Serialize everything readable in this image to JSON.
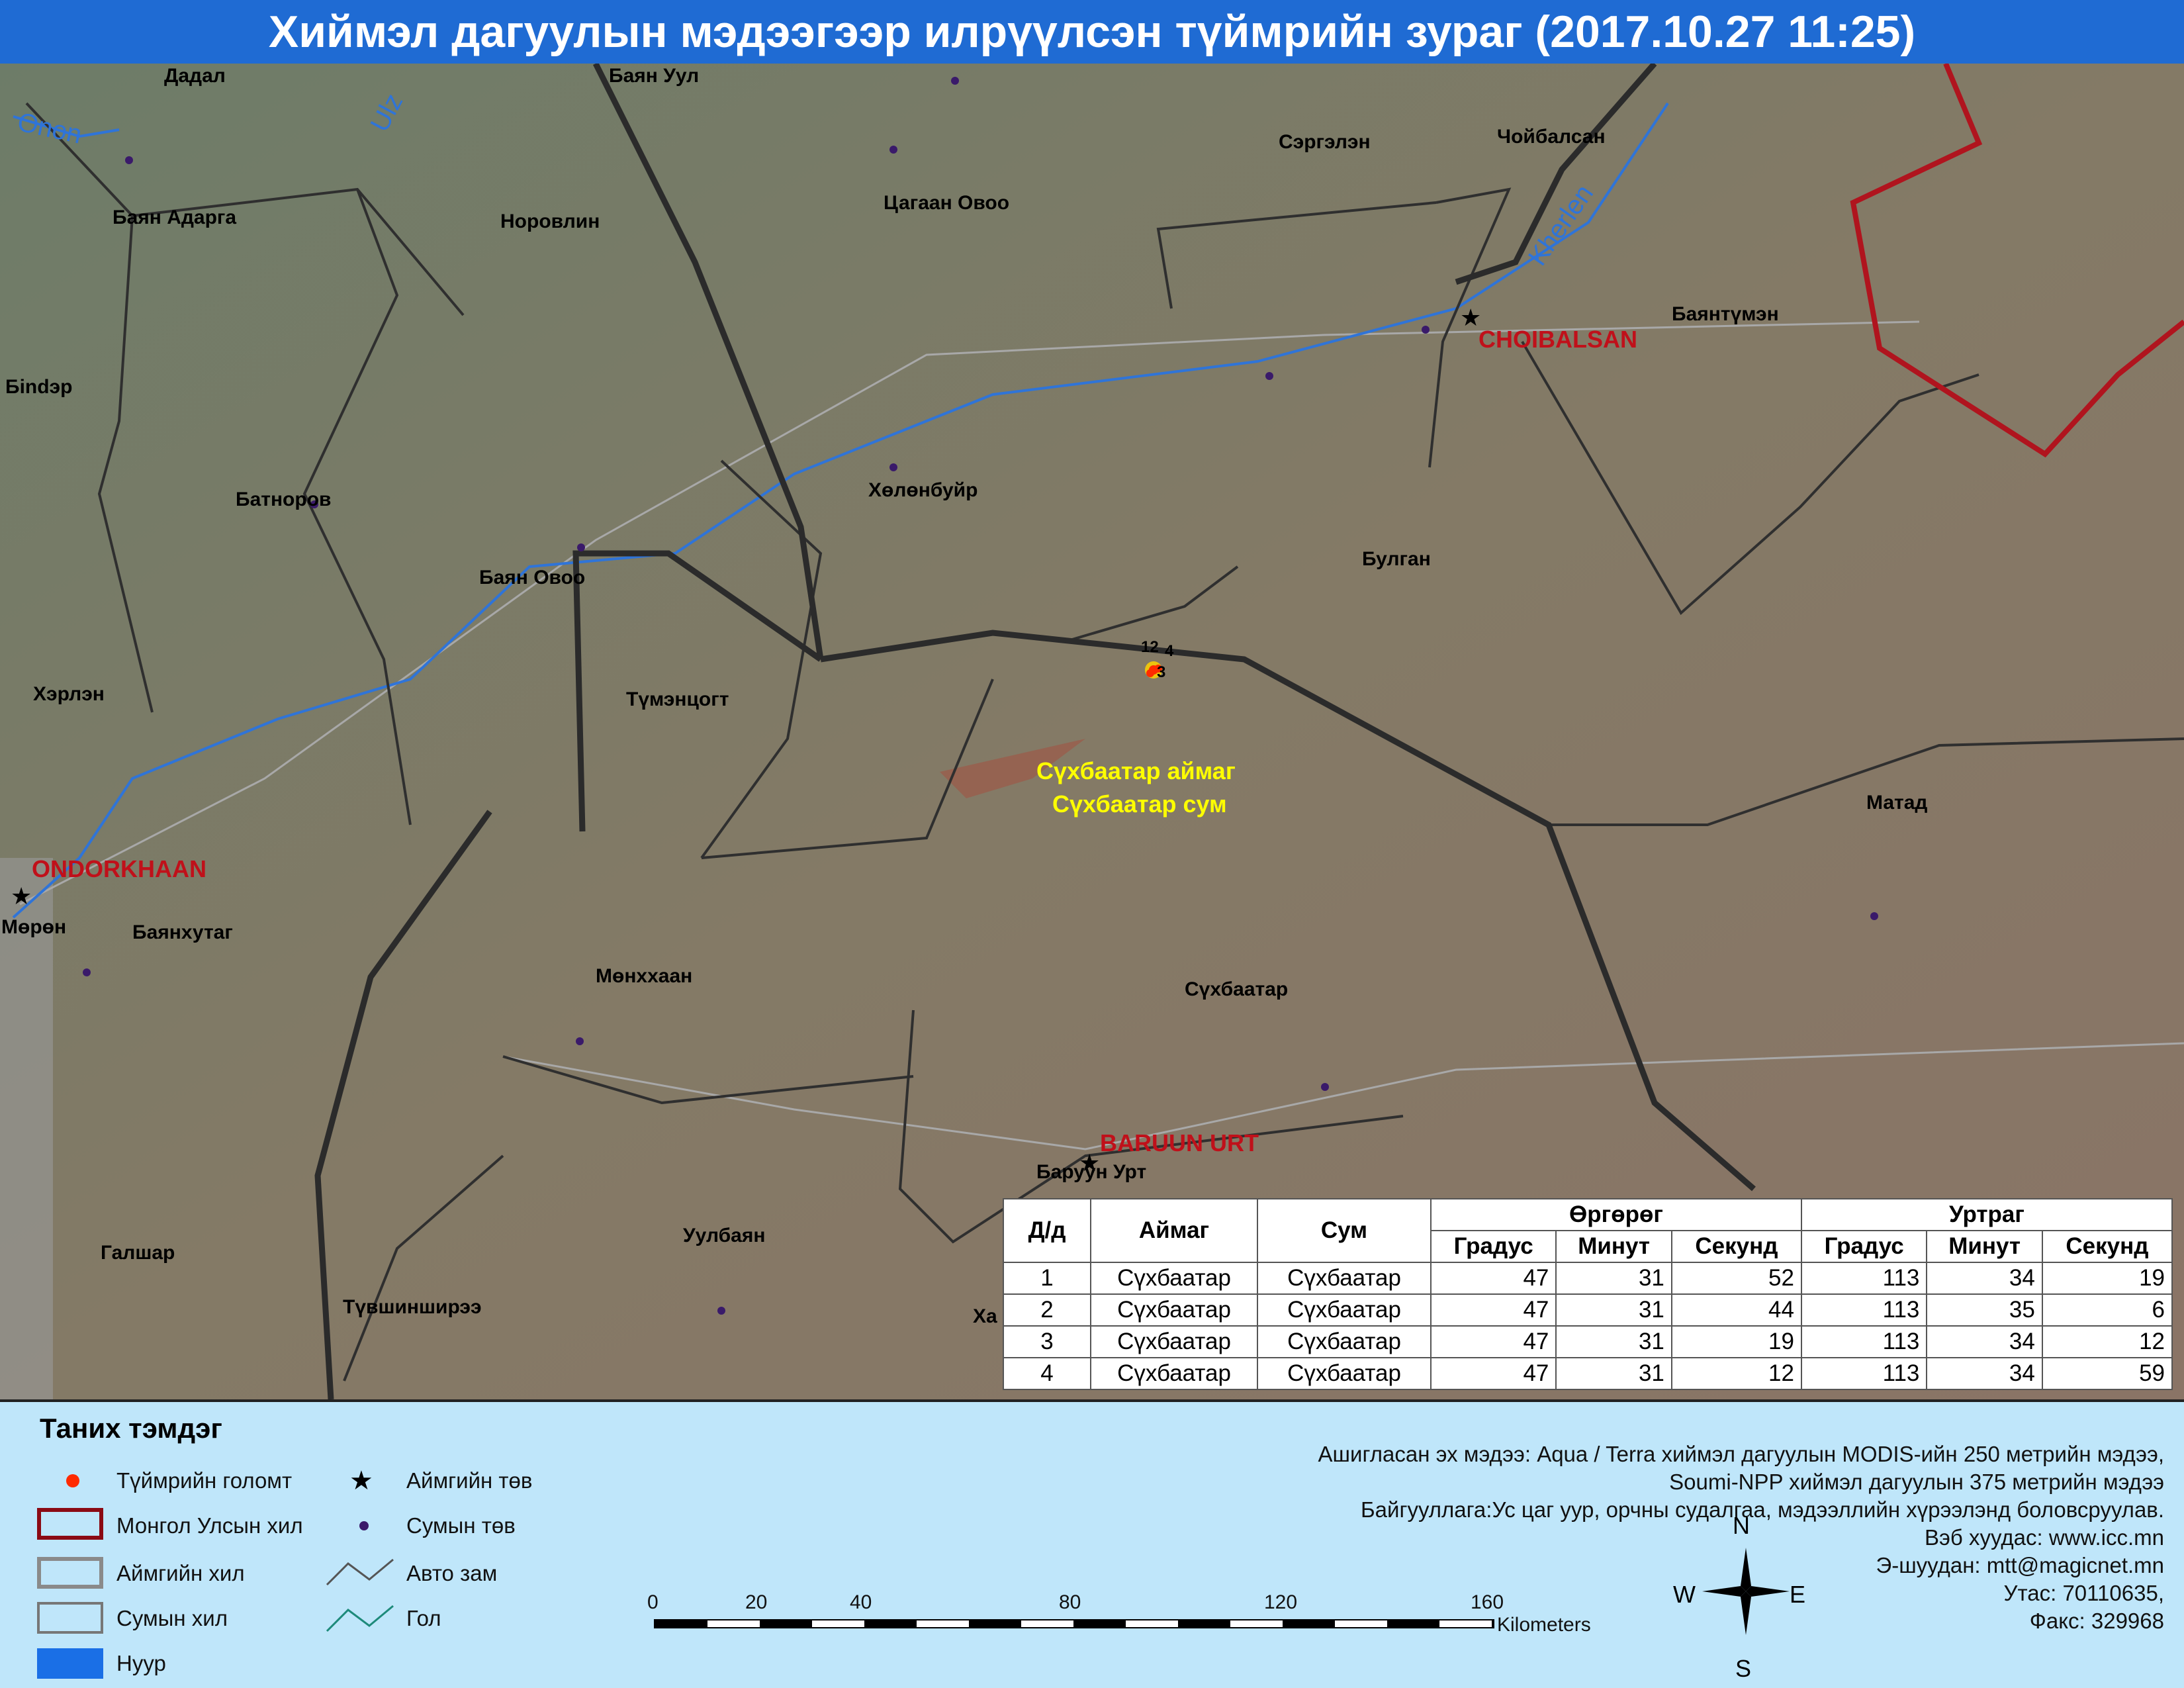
{
  "title": "Хиймэл дагуулын мэдээгээр илрүүлсэн түймрийн зураг  (2017.10.27 11:25)",
  "map": {
    "sum_labels": [
      "Дадал",
      "Баян Адарга",
      "Норовлин",
      "Цагаан Овоо",
      "Баян Уул",
      "Сэргэлэн",
      "Чойбалсан",
      "Бindэр",
      "Батноров",
      "Баян Овоо",
      "Хэрлэн",
      "Түмэнцогт",
      "Хөлөнбуйр",
      "Булган",
      "Баянтүмэн",
      "Матад",
      "Баянхутаг",
      "Мөнххаан",
      "Сүхбаатар",
      "Галшар",
      "Уулбаян",
      "Түвшинширээ",
      "Мөрөн",
      "Баруун Урт",
      "Ха"
    ],
    "aimag_centers": [
      "CHOIBALSAN",
      "ONDORKHAAN",
      "BARUUN URT"
    ],
    "rivers": [
      "Onon",
      "Ulz",
      "Kherlen"
    ],
    "fire_labels": [
      "12",
      "4",
      "3"
    ],
    "fire_location": {
      "aimag": "Сүхбаатар аймаг",
      "sum": "Сүхбаатар сум"
    },
    "colors": {
      "border_country": "#b0141e",
      "border": "#2a2a2a",
      "river": "#2f74d8",
      "fire": "#ff2a00",
      "highlight": "#ffff00",
      "center_label": "#c0101a"
    }
  },
  "table": {
    "headers": {
      "no": "Д/д",
      "aimag": "Аймаг",
      "sum": "Сум",
      "lat": "Өргөрөг",
      "lon": "Уртраг",
      "deg": "Градус",
      "min": "Минут",
      "sec": "Секунд"
    },
    "rows": [
      {
        "no": "1",
        "aimag": "Сүхбаатар",
        "sum": "Сүхбаатар",
        "lat_deg": "47",
        "lat_min": "31",
        "lat_sec": "52",
        "lon_deg": "113",
        "lon_min": "34",
        "lon_sec": "19"
      },
      {
        "no": "2",
        "aimag": "Сүхбаатар",
        "sum": "Сүхбаатар",
        "lat_deg": "47",
        "lat_min": "31",
        "lat_sec": "44",
        "lon_deg": "113",
        "lon_min": "35",
        "lon_sec": "6"
      },
      {
        "no": "3",
        "aimag": "Сүхбаатар",
        "sum": "Сүхбаатар",
        "lat_deg": "47",
        "lat_min": "31",
        "lat_sec": "19",
        "lon_deg": "113",
        "lon_min": "34",
        "lon_sec": "12"
      },
      {
        "no": "4",
        "aimag": "Сүхбаатар",
        "sum": "Сүхбаатар",
        "lat_deg": "47",
        "lat_min": "31",
        "lat_sec": "12",
        "lon_deg": "113",
        "lon_min": "34",
        "lon_sec": "59"
      }
    ]
  },
  "legend": {
    "title": "Таних тэмдэг",
    "fire": "Түймрийн голомт",
    "aimag_center": "Аймгийн төв",
    "country_border": "Монгол Улсын хил",
    "sum_center": "Сумын төв",
    "aimag_border": "Аймгийн хил",
    "road": "Авто зам",
    "sum_border": "Сумын хил",
    "river": "Гол",
    "lake": "Нуур"
  },
  "source": {
    "line1": "Ашигласан эх мэдээ: Aqua / Terra хиймэл дагуулын MODIS-ийн 250 метрийн мэдээ,",
    "line2": "Soumi-NPP хиймэл дагуулын 375 метрийн мэдээ",
    "line3": "Байгууллага:Ус цаг уур, орчны судалгаа, мэдээллийн хүрээлэнд боловсруулав.",
    "line4": "Вэб хуудас: www.icc.mn",
    "line5": "Э-шуудан: mtt@magicnet.mn",
    "line6": "Утас: 70110635,",
    "line7": "Факс: 329968"
  },
  "scale": {
    "ticks": [
      "0",
      "20",
      "40",
      "80",
      "120",
      "160"
    ],
    "unit": "Kilometers"
  },
  "compass": {
    "n": "N",
    "s": "S",
    "e": "E",
    "w": "W"
  }
}
